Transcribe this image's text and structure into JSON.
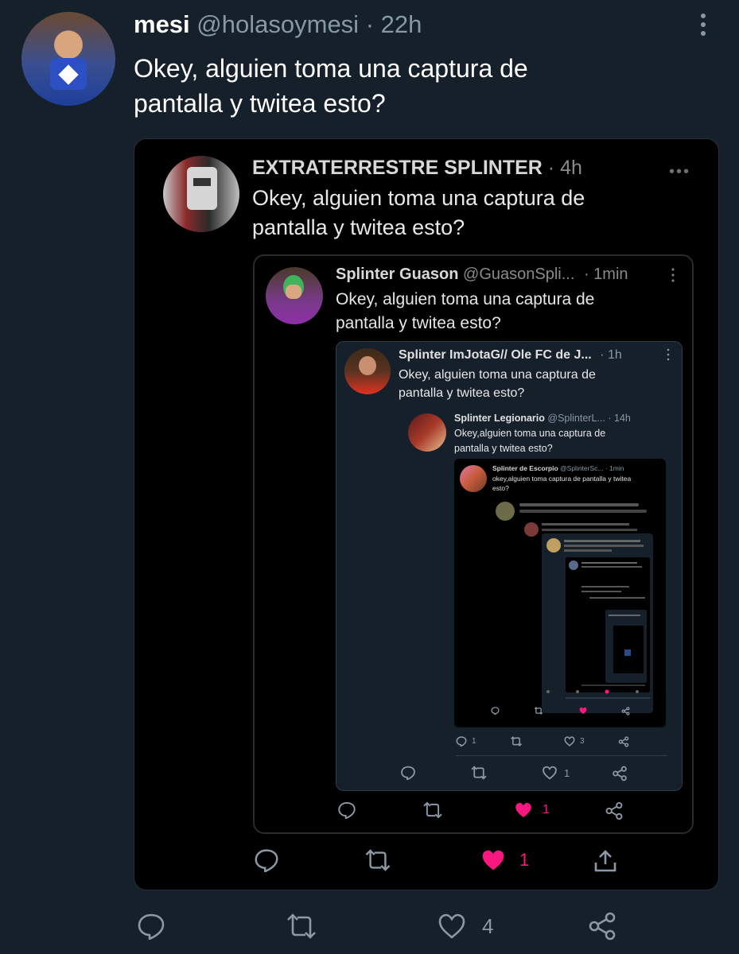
{
  "outer": {
    "display_name": "mesi",
    "handle": "@holasoymesi",
    "separator": "·",
    "time": "22h",
    "text_line1": "Okey, alguien toma una captura de",
    "text_line2": "pantalla y twitea esto?",
    "reply_count": "",
    "retweet_count": "",
    "like_count": "4",
    "share_count": ""
  },
  "level1": {
    "display_name": "EXTRATERRESTRE SPLINTER",
    "time": "· 4h",
    "text_line1": "Okey, alguien toma una captura de",
    "text_line2": "pantalla y twitea esto?",
    "like_count": "1"
  },
  "level2": {
    "display_name": "Splinter Guason",
    "handle": "@GuasonSpli...",
    "time": "· 1min",
    "text_line1": "Okey, alguien toma una captura de",
    "text_line2": "pantalla y twitea esto?",
    "like_count": "1"
  },
  "level3": {
    "display_name": "Splinter ImJotaG// Ole FC de J...",
    "time": "· 1h",
    "text_line1": "Okey, alguien toma una captura de",
    "text_line2": "pantalla y twitea esto?",
    "like_count": "1"
  },
  "level4": {
    "display_name": "Splinter Legionario",
    "handle": "@SplinterL...",
    "time": "· 14h",
    "text_line1": "Okey,alguien toma una captura de",
    "text_line2": "pantalla y twitea esto?",
    "reply_count": "1",
    "like_count": "3"
  },
  "level5": {
    "display_name": "Splinter de Escorpio",
    "handle": "@SplinterSc...",
    "time": "· 1min",
    "text_line1": "okey,alguien toma captura de pantalla y twitea",
    "text_line2": "esto?"
  },
  "colors": {
    "background": "#15202b",
    "nested_black": "#000000",
    "muted": "#8899a6",
    "like_pink": "#f91880"
  }
}
